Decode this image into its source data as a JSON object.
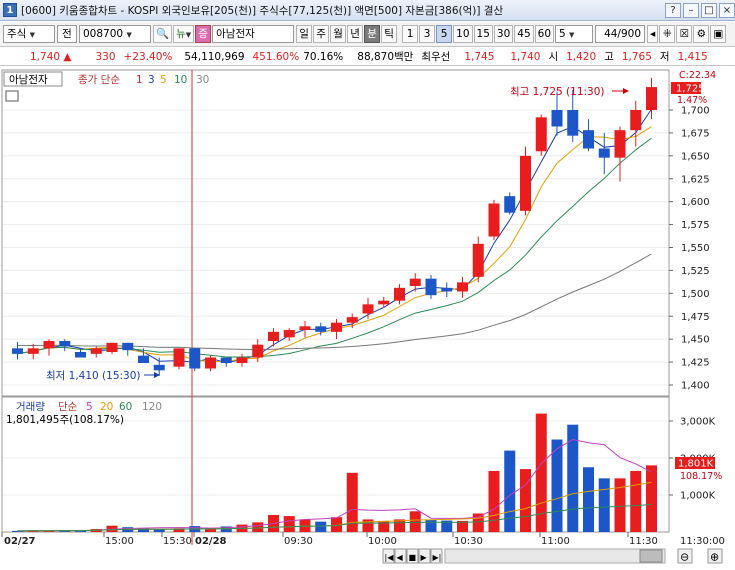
{
  "window": {
    "number": "1",
    "title": "[0600] 키움종합차트 - KOSPI 외국인보유[205(천)] 주식수[77,125(천)] 액면[500] 자본금[386(억)] 결산",
    "buttons": [
      "?",
      "–",
      "□",
      "×"
    ]
  },
  "toolbar": {
    "market": "주식",
    "market_mode": "전",
    "code": "008700",
    "code_btn_extra": "뉴",
    "stock_badge": "증",
    "stock_name": "아남전자",
    "periods": [
      "일",
      "주",
      "월",
      "년",
      "분",
      "틱"
    ],
    "active_period": "분",
    "intervals": [
      "1",
      "3",
      "5",
      "10",
      "15",
      "30",
      "45",
      "60"
    ],
    "active_interval": "5",
    "interval_value": "5",
    "count": "44/900"
  },
  "quote": {
    "price": "1,740",
    "change": "330",
    "change_rate": "+23.40%",
    "volume": "54,110,969",
    "volume_rate": "451.60%",
    "strength": "70.16%",
    "amount": "88,870백만",
    "best_ask_label": "최우선",
    "best_ask": "1,745",
    "best_bid": "1,740",
    "open_label": "시",
    "open": "1,420",
    "high_label": "고",
    "high": "1,765",
    "low_label": "저",
    "low": "1,415"
  },
  "price_panel": {
    "stock_label": "아남전자",
    "ma_prefix": "종가 단순",
    "ma_periods": [
      "1",
      "3",
      "5",
      "10",
      "30"
    ],
    "high_annotation": "최고 1,725 (11:30)",
    "low_annotation": "최저 1,410 (15:30)",
    "current_price_label": "1,725",
    "countdown": "C:22.34",
    "change_label": "1.47%",
    "y_ticks": [
      "1,725",
      "1,700",
      "1,675",
      "1,650",
      "1,625",
      "1,600",
      "1,575",
      "1,550",
      "1,525",
      "1,500",
      "1,475",
      "1,450",
      "1,425",
      "1,400"
    ]
  },
  "volume_panel": {
    "legend_name": "거래량",
    "legend_ma": "단순",
    "legend_periods": [
      "5",
      "20",
      "60",
      "120"
    ],
    "value_text": "1,801,495주(108.17%)",
    "y_ticks": [
      "3,000K",
      "2,000K",
      "1,000K"
    ],
    "current_label": "1,801K",
    "pct_label": "108.17%"
  },
  "time_axis": {
    "labels": [
      "02/27",
      "15:00",
      "15:30",
      "02/28",
      "09:30",
      "10:00",
      "10:30",
      "11:00",
      "11:30"
    ],
    "right_label": "11:30:00"
  },
  "scroll_controls": [
    "|◀",
    "◀",
    "■",
    "▶",
    "▶|"
  ],
  "zoom_controls": [
    "⊖",
    "⊕"
  ],
  "colors": {
    "up": "#e81d1d",
    "down": "#1c56c8",
    "ma3": "#1a3cb0",
    "ma5": "#e0a000",
    "ma10": "#2e8b57",
    "ma30": "#777777",
    "vma": "#c040c0"
  },
  "chart_data": {
    "type": "candlestick",
    "candles": [
      {
        "time": "14:55",
        "open": 1440,
        "high": 1447,
        "low": 1428,
        "close": 1434
      },
      {
        "time": "15:00",
        "open": 1434,
        "high": 1445,
        "low": 1428,
        "close": 1440
      },
      {
        "time": "15:05",
        "open": 1440,
        "high": 1450,
        "low": 1432,
        "close": 1448
      },
      {
        "time": "15:10",
        "open": 1448,
        "high": 1450,
        "low": 1437,
        "close": 1442
      },
      {
        "time": "15:15",
        "open": 1436,
        "high": 1440,
        "low": 1430,
        "close": 1430
      },
      {
        "time": "15:20",
        "open": 1434,
        "high": 1442,
        "low": 1430,
        "close": 1440
      },
      {
        "time": "15:25",
        "open": 1436,
        "high": 1446,
        "low": 1434,
        "close": 1446
      },
      {
        "time": "15:30",
        "open": 1446,
        "high": 1446,
        "low": 1432,
        "close": 1438
      },
      {
        "time": "15:35",
        "open": 1432,
        "high": 1440,
        "low": 1424,
        "close": 1424
      },
      {
        "time": "15:40",
        "open": 1422,
        "high": 1430,
        "low": 1410,
        "close": 1416
      },
      {
        "time": "09:00",
        "open": 1420,
        "high": 1440,
        "low": 1417,
        "close": 1440
      },
      {
        "time": "09:05",
        "open": 1440,
        "high": 1440,
        "low": 1415,
        "close": 1418
      },
      {
        "time": "09:10",
        "open": 1418,
        "high": 1432,
        "low": 1415,
        "close": 1430
      },
      {
        "time": "09:15",
        "open": 1430,
        "high": 1430,
        "low": 1420,
        "close": 1424
      },
      {
        "time": "09:20",
        "open": 1424,
        "high": 1434,
        "low": 1420,
        "close": 1430
      },
      {
        "time": "09:25",
        "open": 1430,
        "high": 1450,
        "low": 1425,
        "close": 1444
      },
      {
        "time": "09:30",
        "open": 1448,
        "high": 1462,
        "low": 1442,
        "close": 1458
      },
      {
        "time": "09:35",
        "open": 1452,
        "high": 1462,
        "low": 1448,
        "close": 1460
      },
      {
        "time": "09:40",
        "open": 1460,
        "high": 1470,
        "low": 1452,
        "close": 1464
      },
      {
        "time": "09:45",
        "open": 1464,
        "high": 1468,
        "low": 1454,
        "close": 1458
      },
      {
        "time": "09:50",
        "open": 1458,
        "high": 1472,
        "low": 1450,
        "close": 1468
      },
      {
        "time": "09:55",
        "open": 1468,
        "high": 1478,
        "low": 1462,
        "close": 1474
      },
      {
        "time": "10:00",
        "open": 1478,
        "high": 1495,
        "low": 1472,
        "close": 1488
      },
      {
        "time": "10:05",
        "open": 1488,
        "high": 1496,
        "low": 1484,
        "close": 1492
      },
      {
        "time": "10:10",
        "open": 1492,
        "high": 1510,
        "low": 1488,
        "close": 1506
      },
      {
        "time": "10:15",
        "open": 1508,
        "high": 1522,
        "low": 1502,
        "close": 1516
      },
      {
        "time": "10:20",
        "open": 1516,
        "high": 1520,
        "low": 1494,
        "close": 1498
      },
      {
        "time": "10:25",
        "open": 1506,
        "high": 1512,
        "low": 1496,
        "close": 1502
      },
      {
        "time": "10:30",
        "open": 1502,
        "high": 1518,
        "low": 1495,
        "close": 1512
      },
      {
        "time": "10:35",
        "open": 1518,
        "high": 1562,
        "low": 1512,
        "close": 1554
      },
      {
        "time": "10:40",
        "open": 1562,
        "high": 1602,
        "low": 1558,
        "close": 1598
      },
      {
        "time": "10:45",
        "open": 1606,
        "high": 1610,
        "low": 1586,
        "close": 1588
      },
      {
        "time": "10:50",
        "open": 1590,
        "high": 1660,
        "low": 1585,
        "close": 1650
      },
      {
        "time": "10:55",
        "open": 1655,
        "high": 1695,
        "low": 1650,
        "close": 1692
      },
      {
        "time": "11:00",
        "open": 1700,
        "high": 1720,
        "low": 1672,
        "close": 1682
      },
      {
        "time": "11:05",
        "open": 1700,
        "high": 1722,
        "low": 1665,
        "close": 1672
      },
      {
        "time": "11:10",
        "open": 1678,
        "high": 1690,
        "low": 1655,
        "close": 1658
      },
      {
        "time": "11:15",
        "open": 1658,
        "high": 1675,
        "low": 1630,
        "close": 1648
      },
      {
        "time": "11:20",
        "open": 1648,
        "high": 1682,
        "low": 1622,
        "close": 1678
      },
      {
        "time": "11:25",
        "open": 1678,
        "high": 1710,
        "low": 1660,
        "close": 1700
      },
      {
        "time": "11:30",
        "open": 1700,
        "high": 1735,
        "low": 1690,
        "close": 1725
      }
    ],
    "volumes_k": [
      30,
      40,
      30,
      50,
      40,
      80,
      170,
      130,
      110,
      80,
      100,
      160,
      80,
      150,
      200,
      260,
      460,
      430,
      340,
      280,
      400,
      1600,
      340,
      300,
      340,
      560,
      330,
      310,
      300,
      500,
      1650,
      2200,
      1700,
      3200,
      2500,
      2900,
      1750,
      1450,
      1450,
      1650,
      1801
    ],
    "y_range": [
      1390,
      1740
    ],
    "volume_range_k": [
      0,
      3500
    ]
  }
}
